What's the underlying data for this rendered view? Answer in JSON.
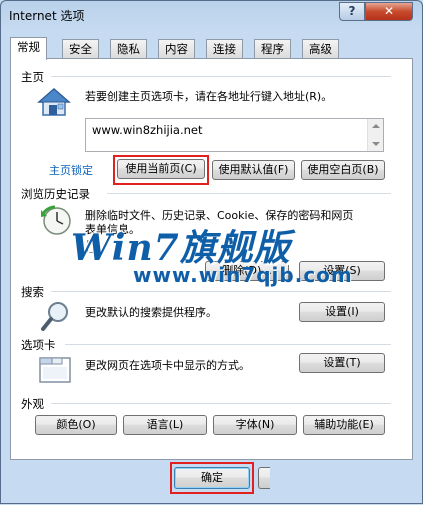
{
  "window": {
    "title": "Internet 选项",
    "help_label": "?",
    "close_label": "✕"
  },
  "tabs": [
    {
      "label": "常规",
      "active": true
    },
    {
      "label": "安全"
    },
    {
      "label": "隐私"
    },
    {
      "label": "内容"
    },
    {
      "label": "连接"
    },
    {
      "label": "程序"
    },
    {
      "label": "高级"
    }
  ],
  "home": {
    "label": "主页",
    "description": "若要创建主页选项卡，请在各地址行键入地址(R)。",
    "address": "www.win8zhijia.net",
    "lock_link": "主页锁定",
    "buttons": {
      "use_current": "使用当前页(C)",
      "use_default": "使用默认值(F)",
      "use_blank": "使用空白页(B)"
    }
  },
  "history": {
    "label": "浏览历史记录",
    "description_line1": "删除临时文件、历史记录、Cookie、保存的密码和网页",
    "description_line2": "表单信息。",
    "delete_label": "删除(D)...",
    "settings_label": "设置(S)"
  },
  "search": {
    "label": "搜索",
    "description": "更改默认的搜索提供程序。",
    "settings_label": "设置(I)"
  },
  "tabs_group": {
    "label": "选项卡",
    "description": "更改网页在选项卡中显示的方式。",
    "settings_label": "设置(T)"
  },
  "appearance": {
    "label": "外观",
    "buttons": {
      "colors": "颜色(O)",
      "languages": "语言(L)",
      "fonts": "字体(N)",
      "accessibility": "辅助功能(E)"
    }
  },
  "footer": {
    "ok_label": "确定"
  },
  "watermark": {
    "line1": "Win7旗舰版",
    "line2": "www.win7qjb.com"
  },
  "colors": {
    "highlight_red": "#e32020",
    "link_blue": "#0b63b8",
    "watermark_blue": "#0f5ea8"
  }
}
